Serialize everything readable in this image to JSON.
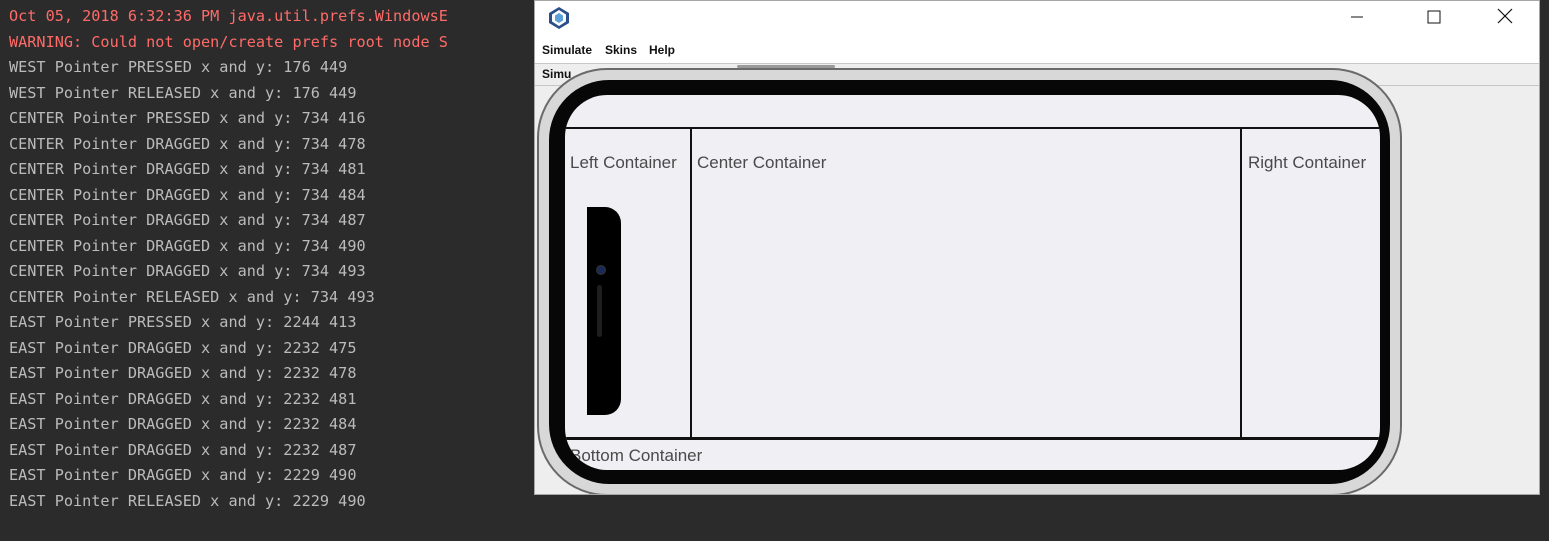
{
  "console": {
    "lines": [
      {
        "text": "Oct 05, 2018 6:32:36 PM java.util.prefs.WindowsE",
        "type": "err"
      },
      {
        "text": "WARNING: Could not open/create prefs root node S",
        "type": "err"
      },
      {
        "text": "WEST Pointer PRESSED x and y: 176 449",
        "type": "out"
      },
      {
        "text": "WEST Pointer RELEASED x and y: 176 449",
        "type": "out"
      },
      {
        "text": "CENTER Pointer PRESSED x and y: 734 416",
        "type": "out"
      },
      {
        "text": "CENTER Pointer DRAGGED x and y: 734 478",
        "type": "out"
      },
      {
        "text": "CENTER Pointer DRAGGED x and y: 734 481",
        "type": "out"
      },
      {
        "text": "CENTER Pointer DRAGGED x and y: 734 484",
        "type": "out"
      },
      {
        "text": "CENTER Pointer DRAGGED x and y: 734 487",
        "type": "out"
      },
      {
        "text": "CENTER Pointer DRAGGED x and y: 734 490",
        "type": "out"
      },
      {
        "text": "CENTER Pointer DRAGGED x and y: 734 493",
        "type": "out"
      },
      {
        "text": "CENTER Pointer RELEASED x and y: 734 493",
        "type": "out"
      },
      {
        "text": "EAST Pointer PRESSED x and y: 2244 413",
        "type": "out"
      },
      {
        "text": "EAST Pointer DRAGGED x and y: 2232 475",
        "type": "out"
      },
      {
        "text": "EAST Pointer DRAGGED x and y: 2232 478",
        "type": "out"
      },
      {
        "text": "EAST Pointer DRAGGED x and y: 2232 481",
        "type": "out"
      },
      {
        "text": "EAST Pointer DRAGGED x and y: 2232 484",
        "type": "out"
      },
      {
        "text": "EAST Pointer DRAGGED x and y: 2232 487",
        "type": "out"
      },
      {
        "text": "EAST Pointer DRAGGED x and y: 2229 490",
        "type": "out"
      },
      {
        "text": "EAST Pointer RELEASED x and y: 2229 490",
        "type": "out"
      }
    ],
    "colors": {
      "error": "#ff6b68",
      "output": "#bbbbbb",
      "background": "#2b2b2b"
    }
  },
  "window": {
    "icon": "codename-one-app-icon",
    "controls": {
      "minimize": "minimize-icon",
      "maximize": "maximize-icon",
      "close": "close-icon"
    },
    "menu": [
      "Simulate",
      "Skins",
      "Help"
    ],
    "toolbar_label": "Simu"
  },
  "app": {
    "regions": {
      "left": "Left Container",
      "center": "Center Container",
      "right": "Right Container",
      "bottom": "Bottom Container"
    }
  }
}
